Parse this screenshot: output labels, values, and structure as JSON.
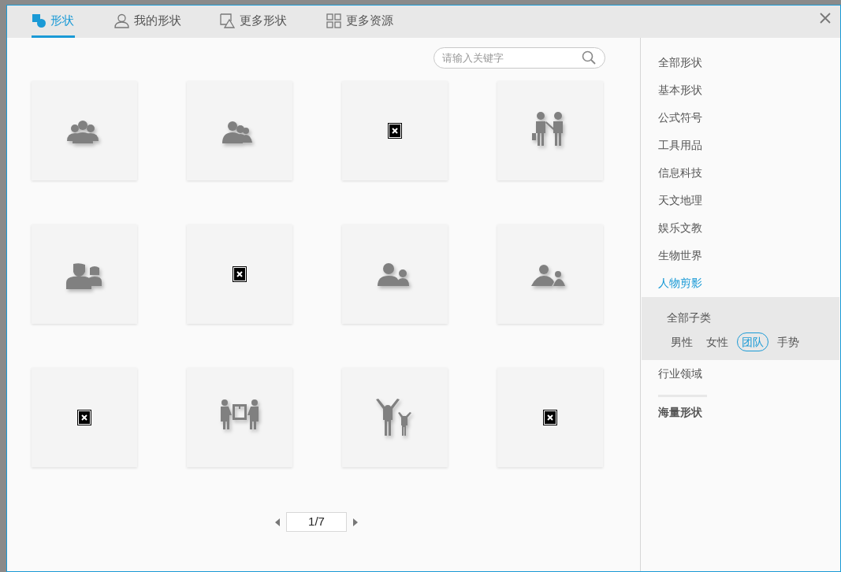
{
  "tabs": [
    {
      "label": "形状",
      "selected": true
    },
    {
      "label": "我的形状",
      "selected": false
    },
    {
      "label": "更多形状",
      "selected": false
    },
    {
      "label": "更多资源",
      "selected": false
    }
  ],
  "search": {
    "placeholder": "请输入关键字"
  },
  "tiles": [
    {
      "kind": "group"
    },
    {
      "kind": "group-leader"
    },
    {
      "kind": "broken"
    },
    {
      "kind": "walking-pair"
    },
    {
      "kind": "man-woman"
    },
    {
      "kind": "broken"
    },
    {
      "kind": "adult-child"
    },
    {
      "kind": "adult-child-round"
    },
    {
      "kind": "broken"
    },
    {
      "kind": "carrying"
    },
    {
      "kind": "cheering"
    },
    {
      "kind": "broken"
    }
  ],
  "pager": {
    "page": "1/7"
  },
  "categories": [
    {
      "label": "全部形状",
      "selected": false
    },
    {
      "label": "基本形状",
      "selected": false
    },
    {
      "label": "公式符号",
      "selected": false
    },
    {
      "label": "工具用品",
      "selected": false
    },
    {
      "label": "信息科技",
      "selected": false
    },
    {
      "label": "天文地理",
      "selected": false
    },
    {
      "label": "娱乐文教",
      "selected": false
    },
    {
      "label": "生物世界",
      "selected": false
    },
    {
      "label": "人物剪影",
      "selected": true,
      "subcategories": {
        "all_label": "全部子类",
        "items": [
          {
            "label": "男性",
            "selected": false
          },
          {
            "label": "女性",
            "selected": false
          },
          {
            "label": "团队",
            "selected": true
          },
          {
            "label": "手势",
            "selected": false
          }
        ]
      }
    },
    {
      "label": "行业领域",
      "selected": false
    }
  ],
  "section_heading": "海量形状"
}
